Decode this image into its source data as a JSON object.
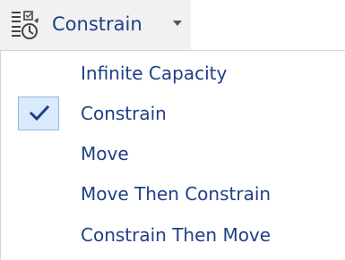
{
  "toolbar": {
    "button_label": "Constrain",
    "button_icon": "constraint-mode-icon",
    "caret_icon": "dropdown-caret-icon"
  },
  "menu": {
    "items": [
      {
        "label": "Infinite Capacity",
        "checked": false
      },
      {
        "label": "Constrain",
        "checked": true,
        "check_icon": "checkmark-icon"
      },
      {
        "label": "Move",
        "checked": false
      },
      {
        "label": "Move Then Constrain",
        "checked": false
      },
      {
        "label": "Constrain Then Move",
        "checked": false
      }
    ]
  },
  "colors": {
    "text": "#1f3f87",
    "selection_fill": "#d9eafb",
    "selection_border": "#8fb8e6"
  }
}
